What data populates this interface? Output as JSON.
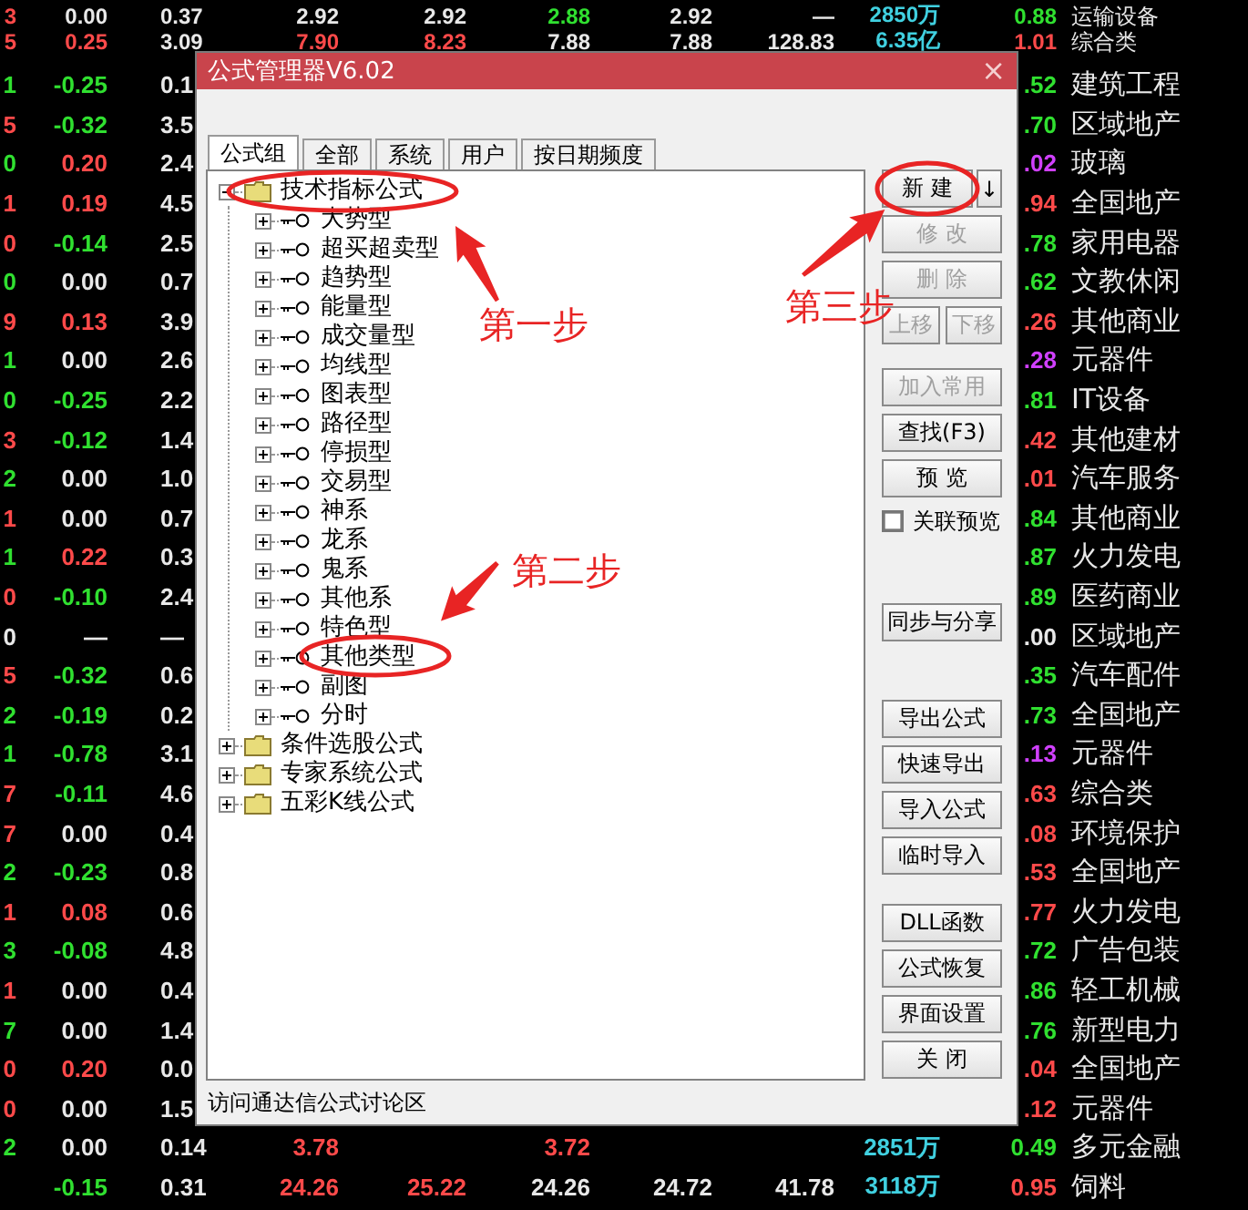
{
  "quotes": {
    "rows": [
      {
        "column_1": {
          "text": "3",
          "color": "#ff4a4a"
        },
        "column_2": {
          "text": "0.00",
          "color": "#e8e8e8"
        },
        "column_3": {
          "text": "0.37",
          "color": "#e8e8e8"
        },
        "column_4": {
          "text": "2.92",
          "color": "#e8e8e8"
        },
        "column_5": {
          "text": "2.92",
          "color": "#e8e8e8"
        },
        "column_6": {
          "text": "2.88",
          "color": "#30e030"
        },
        "column_7": {
          "text": "2.92",
          "color": "#e8e8e8"
        },
        "column_8": {
          "text": "—",
          "color": "#e8e8e8"
        },
        "column_9": {
          "text": "2850万",
          "color": "#40d0e0"
        },
        "column_10": {
          "text": "0.88",
          "color": "#30e030"
        },
        "industry": "运输设备"
      },
      {
        "column_1": {
          "text": "5",
          "color": "#ff4a4a"
        },
        "column_2": {
          "text": "0.25",
          "color": "#ff4a4a"
        },
        "column_3": {
          "text": "3.09",
          "color": "#e8e8e8"
        },
        "column_4": {
          "text": "7.90",
          "color": "#ff4a4a"
        },
        "column_5": {
          "text": "8.23",
          "color": "#ff4a4a"
        },
        "column_6": {
          "text": "7.88",
          "color": "#e8e8e8"
        },
        "column_7": {
          "text": "7.88",
          "color": "#e8e8e8"
        },
        "column_8": {
          "text": "128.83",
          "color": "#e8e8e8"
        },
        "column_9": {
          "text": "6.35亿",
          "color": "#40d0e0"
        },
        "column_10": {
          "text": "1.01",
          "color": "#ff4a4a"
        },
        "industry": "综合类"
      },
      {
        "column_1": {
          "text": "1",
          "color": "#30e030"
        },
        "column_2": {
          "text": "-0.25",
          "color": "#30e030"
        },
        "column_3": {
          "text": "0.1",
          "color": "#e8e8e8"
        },
        "column_10": {
          "text": ".52",
          "color": "#30e030"
        },
        "industry": "建筑工程"
      },
      {
        "column_1": {
          "text": "5",
          "color": "#ff4a4a"
        },
        "column_2": {
          "text": "-0.32",
          "color": "#30e030"
        },
        "column_3": {
          "text": "3.5",
          "color": "#e8e8e8"
        },
        "column_10": {
          "text": ".70",
          "color": "#30e030"
        },
        "industry": "区域地产"
      },
      {
        "column_1": {
          "text": "0",
          "color": "#30e030"
        },
        "column_2": {
          "text": "0.20",
          "color": "#ff4a4a"
        },
        "column_3": {
          "text": "2.4",
          "color": "#e8e8e8"
        },
        "column_10": {
          "text": ".02",
          "color": "#d040ff"
        },
        "industry": "玻璃"
      },
      {
        "column_1": {
          "text": "1",
          "color": "#ff4a4a"
        },
        "column_2": {
          "text": "0.19",
          "color": "#ff4a4a"
        },
        "column_3": {
          "text": "4.5",
          "color": "#e8e8e8"
        },
        "column_10": {
          "text": ".94",
          "color": "#ff4a4a"
        },
        "industry": "全国地产"
      },
      {
        "column_1": {
          "text": "0",
          "color": "#ff4a4a"
        },
        "column_2": {
          "text": "-0.14",
          "color": "#30e030"
        },
        "column_3": {
          "text": "2.5",
          "color": "#e8e8e8"
        },
        "column_10": {
          "text": ".78",
          "color": "#30e030"
        },
        "industry": "家用电器"
      },
      {
        "column_1": {
          "text": "0",
          "color": "#30e030"
        },
        "column_2": {
          "text": "0.00",
          "color": "#e8e8e8"
        },
        "column_3": {
          "text": "0.7",
          "color": "#e8e8e8"
        },
        "column_10": {
          "text": ".62",
          "color": "#30e030"
        },
        "industry": "文教休闲"
      },
      {
        "column_1": {
          "text": "9",
          "color": "#ff4a4a"
        },
        "column_2": {
          "text": "0.13",
          "color": "#ff4a4a"
        },
        "column_3": {
          "text": "3.9",
          "color": "#e8e8e8"
        },
        "column_10": {
          "text": ".26",
          "color": "#ff4a4a"
        },
        "industry": "其他商业"
      },
      {
        "column_1": {
          "text": "1",
          "color": "#30e030"
        },
        "column_2": {
          "text": "0.00",
          "color": "#e8e8e8"
        },
        "column_3": {
          "text": "2.6",
          "color": "#e8e8e8"
        },
        "column_10": {
          "text": ".28",
          "color": "#d040ff"
        },
        "industry": "元器件"
      },
      {
        "column_1": {
          "text": "0",
          "color": "#30e030"
        },
        "column_2": {
          "text": "-0.25",
          "color": "#30e030"
        },
        "column_3": {
          "text": "2.2",
          "color": "#e8e8e8"
        },
        "column_10": {
          "text": ".81",
          "color": "#30e030"
        },
        "industry": "IT设备"
      },
      {
        "column_1": {
          "text": "3",
          "color": "#ff4a4a"
        },
        "column_2": {
          "text": "-0.12",
          "color": "#30e030"
        },
        "column_3": {
          "text": "1.4",
          "color": "#e8e8e8"
        },
        "column_10": {
          "text": ".42",
          "color": "#ff4a4a"
        },
        "industry": "其他建材"
      },
      {
        "column_1": {
          "text": "2",
          "color": "#30e030"
        },
        "column_2": {
          "text": "0.00",
          "color": "#e8e8e8"
        },
        "column_3": {
          "text": "1.0",
          "color": "#e8e8e8"
        },
        "column_10": {
          "text": ".01",
          "color": "#ff4a4a"
        },
        "industry": "汽车服务"
      },
      {
        "column_1": {
          "text": "1",
          "color": "#ff4a4a"
        },
        "column_2": {
          "text": "0.00",
          "color": "#e8e8e8"
        },
        "column_3": {
          "text": "0.7",
          "color": "#e8e8e8"
        },
        "column_10": {
          "text": ".84",
          "color": "#30e030"
        },
        "industry": "其他商业"
      },
      {
        "column_1": {
          "text": "1",
          "color": "#30e030"
        },
        "column_2": {
          "text": "0.22",
          "color": "#ff4a4a"
        },
        "column_3": {
          "text": "0.3",
          "color": "#e8e8e8"
        },
        "column_10": {
          "text": ".87",
          "color": "#30e030"
        },
        "industry": "火力发电"
      },
      {
        "column_1": {
          "text": "0",
          "color": "#ff4a4a"
        },
        "column_2": {
          "text": "-0.10",
          "color": "#30e030"
        },
        "column_3": {
          "text": "2.4",
          "color": "#e8e8e8"
        },
        "column_10": {
          "text": ".89",
          "color": "#30e030"
        },
        "industry": "医药商业"
      },
      {
        "column_1": {
          "text": "0",
          "color": "#e8e8e8"
        },
        "column_2": {
          "text": "—",
          "color": "#e8e8e8"
        },
        "column_3": {
          "text": "—",
          "color": "#e8e8e8"
        },
        "column_10": {
          "text": ".00",
          "color": "#e8e8e8"
        },
        "industry": "区域地产"
      },
      {
        "column_1": {
          "text": "5",
          "color": "#ff4a4a"
        },
        "column_2": {
          "text": "-0.32",
          "color": "#30e030"
        },
        "column_3": {
          "text": "0.6",
          "color": "#e8e8e8"
        },
        "column_10": {
          "text": ".35",
          "color": "#30e030"
        },
        "industry": "汽车配件"
      },
      {
        "column_1": {
          "text": "2",
          "color": "#30e030"
        },
        "column_2": {
          "text": "-0.19",
          "color": "#30e030"
        },
        "column_3": {
          "text": "0.2",
          "color": "#e8e8e8"
        },
        "column_10": {
          "text": ".73",
          "color": "#30e030"
        },
        "industry": "全国地产"
      },
      {
        "column_1": {
          "text": "1",
          "color": "#30e030"
        },
        "column_2": {
          "text": "-0.78",
          "color": "#30e030"
        },
        "column_3": {
          "text": "3.1",
          "color": "#e8e8e8"
        },
        "column_10": {
          "text": ".13",
          "color": "#d040ff"
        },
        "industry": "元器件"
      },
      {
        "column_1": {
          "text": "7",
          "color": "#ff4a4a"
        },
        "column_2": {
          "text": "-0.11",
          "color": "#30e030"
        },
        "column_3": {
          "text": "4.6",
          "color": "#e8e8e8"
        },
        "column_10": {
          "text": ".63",
          "color": "#ff4a4a"
        },
        "industry": "综合类"
      },
      {
        "column_1": {
          "text": "7",
          "color": "#ff4a4a"
        },
        "column_2": {
          "text": "0.00",
          "color": "#e8e8e8"
        },
        "column_3": {
          "text": "0.4",
          "color": "#e8e8e8"
        },
        "column_10": {
          "text": ".08",
          "color": "#ff4a4a"
        },
        "industry": "环境保护"
      },
      {
        "column_1": {
          "text": "2",
          "color": "#30e030"
        },
        "column_2": {
          "text": "-0.23",
          "color": "#30e030"
        },
        "column_3": {
          "text": "0.8",
          "color": "#e8e8e8"
        },
        "column_10": {
          "text": ".53",
          "color": "#ff4a4a"
        },
        "industry": "全国地产"
      },
      {
        "column_1": {
          "text": "1",
          "color": "#ff4a4a"
        },
        "column_2": {
          "text": "0.08",
          "color": "#ff4a4a"
        },
        "column_3": {
          "text": "0.6",
          "color": "#e8e8e8"
        },
        "column_10": {
          "text": ".77",
          "color": "#ff4a4a"
        },
        "industry": "火力发电"
      },
      {
        "column_1": {
          "text": "3",
          "color": "#30e030"
        },
        "column_2": {
          "text": "-0.08",
          "color": "#30e030"
        },
        "column_3": {
          "text": "4.8",
          "color": "#e8e8e8"
        },
        "column_10": {
          "text": ".72",
          "color": "#30e030"
        },
        "industry": "广告包装"
      },
      {
        "column_1": {
          "text": "1",
          "color": "#ff4a4a"
        },
        "column_2": {
          "text": "0.00",
          "color": "#e8e8e8"
        },
        "column_3": {
          "text": "0.4",
          "color": "#e8e8e8"
        },
        "column_10": {
          "text": ".86",
          "color": "#30e030"
        },
        "industry": "轻工机械"
      },
      {
        "column_1": {
          "text": "7",
          "color": "#30e030"
        },
        "column_2": {
          "text": "0.00",
          "color": "#e8e8e8"
        },
        "column_3": {
          "text": "1.4",
          "color": "#e8e8e8"
        },
        "column_10": {
          "text": ".76",
          "color": "#30e030"
        },
        "industry": "新型电力"
      },
      {
        "column_1": {
          "text": "0",
          "color": "#ff4a4a"
        },
        "column_2": {
          "text": "0.20",
          "color": "#ff4a4a"
        },
        "column_3": {
          "text": "0.0",
          "color": "#e8e8e8"
        },
        "column_10": {
          "text": ".04",
          "color": "#ff4a4a"
        },
        "industry": "全国地产"
      },
      {
        "column_1": {
          "text": "0",
          "color": "#ff4a4a"
        },
        "column_2": {
          "text": "0.00",
          "color": "#e8e8e8"
        },
        "column_3": {
          "text": "1.5",
          "color": "#e8e8e8"
        },
        "column_10": {
          "text": ".12",
          "color": "#ff4a4a"
        },
        "industry": "元器件"
      },
      {
        "column_1": {
          "text": "2",
          "color": "#30e030"
        },
        "column_2": {
          "text": "0.00",
          "color": "#e8e8e8"
        },
        "column_3": {
          "text": "0.14",
          "color": "#e8e8e8"
        },
        "column_4": {
          "text": "3.78",
          "color": "#ff4a4a"
        },
        "column_6": {
          "text": "3.72",
          "color": "#ff4a4a"
        },
        "column_9": {
          "text": "2851万",
          "color": "#40d0e0"
        },
        "column_10": {
          "text": "0.49",
          "color": "#30e030"
        },
        "industry": "多元金融"
      },
      {
        "column_2": {
          "text": "-0.15",
          "color": "#30e030"
        },
        "column_3": {
          "text": "0.31",
          "color": "#e8e8e8"
        },
        "column_4": {
          "text": "24.26",
          "color": "#ff4a4a"
        },
        "column_5": {
          "text": "25.22",
          "color": "#ff4a4a"
        },
        "column_6": {
          "text": "24.26",
          "color": "#e8e8e8"
        },
        "column_7": {
          "text": "24.72",
          "color": "#e8e8e8"
        },
        "column_8": {
          "text": "41.78",
          "color": "#e8e8e8"
        },
        "column_9": {
          "text": "3118万",
          "color": "#40d0e0"
        },
        "column_10": {
          "text": "0.95",
          "color": "#ff4a4a"
        },
        "industry": "饲料"
      }
    ]
  },
  "dialog": {
    "title": "公式管理器V6.02",
    "close": "×",
    "tabs": [
      {
        "label": "公式组",
        "selected": true
      },
      {
        "label": "全部",
        "selected": false
      },
      {
        "label": "系统",
        "selected": false
      },
      {
        "label": "用户",
        "selected": false
      },
      {
        "label": "按日期频度",
        "selected": false
      }
    ],
    "tree": [
      {
        "label": "技术指标公式",
        "kind": "folder",
        "expanded": true,
        "children": [
          {
            "label": "大势型",
            "kind": "group",
            "expanded": false
          },
          {
            "label": "超买超卖型",
            "kind": "group",
            "expanded": false
          },
          {
            "label": "趋势型",
            "kind": "group",
            "expanded": false
          },
          {
            "label": "能量型",
            "kind": "group",
            "expanded": false
          },
          {
            "label": "成交量型",
            "kind": "group",
            "expanded": false
          },
          {
            "label": "均线型",
            "kind": "group",
            "expanded": false
          },
          {
            "label": "图表型",
            "kind": "group",
            "expanded": false
          },
          {
            "label": "路径型",
            "kind": "group",
            "expanded": false
          },
          {
            "label": "停损型",
            "kind": "group",
            "expanded": false
          },
          {
            "label": "交易型",
            "kind": "group",
            "expanded": false
          },
          {
            "label": "神系",
            "kind": "group",
            "expanded": false
          },
          {
            "label": "龙系",
            "kind": "group",
            "expanded": false
          },
          {
            "label": "鬼系",
            "kind": "group",
            "expanded": false
          },
          {
            "label": "其他系",
            "kind": "group",
            "expanded": false
          },
          {
            "label": "特色型",
            "kind": "group",
            "expanded": false
          },
          {
            "label": "其他类型",
            "kind": "group",
            "expanded": false
          },
          {
            "label": "副图",
            "kind": "group",
            "expanded": false
          },
          {
            "label": "分时",
            "kind": "group",
            "expanded": false
          }
        ]
      },
      {
        "label": "条件选股公式",
        "kind": "folder",
        "expanded": false
      },
      {
        "label": "专家系统公式",
        "kind": "folder",
        "expanded": false
      },
      {
        "label": "五彩K线公式",
        "kind": "folder",
        "expanded": false
      }
    ],
    "button_groups": [
      [
        {
          "kind": "split",
          "label": "新 建",
          "arrow": "↓",
          "disabled": false
        },
        {
          "kind": "button",
          "label": "修 改",
          "disabled": true
        },
        {
          "kind": "button",
          "label": "删 除",
          "disabled": true
        },
        {
          "kind": "pair",
          "buttons": [
            {
              "label": "上移",
              "disabled": true
            },
            {
              "label": "下移",
              "disabled": true
            }
          ]
        }
      ],
      [
        {
          "kind": "button",
          "label": "加入常用",
          "disabled": true
        },
        {
          "kind": "button",
          "label": "查找(F3)",
          "disabled": false
        },
        {
          "kind": "button",
          "label": "预 览",
          "disabled": false
        },
        {
          "kind": "checkbox",
          "label": "关联预览",
          "checked": false
        }
      ],
      [
        {
          "kind": "button",
          "label": "同步与分享",
          "disabled": false
        }
      ],
      [
        {
          "kind": "button",
          "label": "导出公式",
          "disabled": false
        },
        {
          "kind": "button",
          "label": "快速导出",
          "disabled": false
        },
        {
          "kind": "button",
          "label": "导入公式",
          "disabled": false
        },
        {
          "kind": "button",
          "label": "临时导入",
          "disabled": false
        }
      ],
      [
        {
          "kind": "button",
          "label": "DLL函数",
          "disabled": false
        },
        {
          "kind": "button",
          "label": "公式恢复",
          "disabled": false
        },
        {
          "kind": "button",
          "label": "界面设置",
          "disabled": false
        },
        {
          "kind": "button",
          "label": "关 闭",
          "disabled": false
        }
      ]
    ],
    "status": "访问通达信公式讨论区"
  },
  "annotations": [
    {
      "text": "第一步"
    },
    {
      "text": "第二步"
    },
    {
      "text": "第三步"
    }
  ]
}
